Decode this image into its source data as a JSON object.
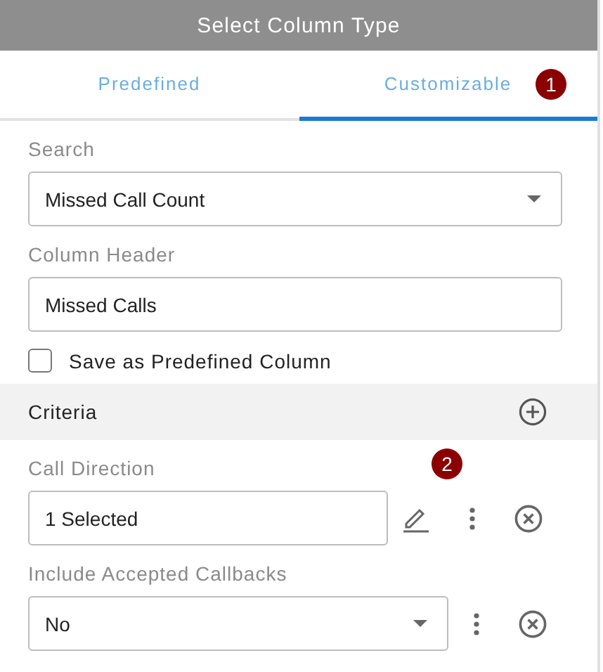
{
  "window": {
    "title": "Select Column Type"
  },
  "tabs": [
    {
      "label": "Predefined",
      "selected": false
    },
    {
      "label": "Customizable",
      "selected": true,
      "badge": "1"
    }
  ],
  "fields": [
    {
      "label": "Search",
      "kind": "select",
      "value": "Missed Call Count"
    },
    {
      "label": "Column Header",
      "kind": "text",
      "value": "Missed Calls"
    }
  ],
  "save_as_predefined": {
    "label": "Save as Predefined Column",
    "checked": false
  },
  "criteria": {
    "title": "Criteria",
    "items": [
      {
        "label": "Call Direction",
        "kind": "multi",
        "value": "1 Selected",
        "badge": "2"
      },
      {
        "label": "Include Accepted Callbacks",
        "kind": "select",
        "value": "No"
      }
    ]
  }
}
